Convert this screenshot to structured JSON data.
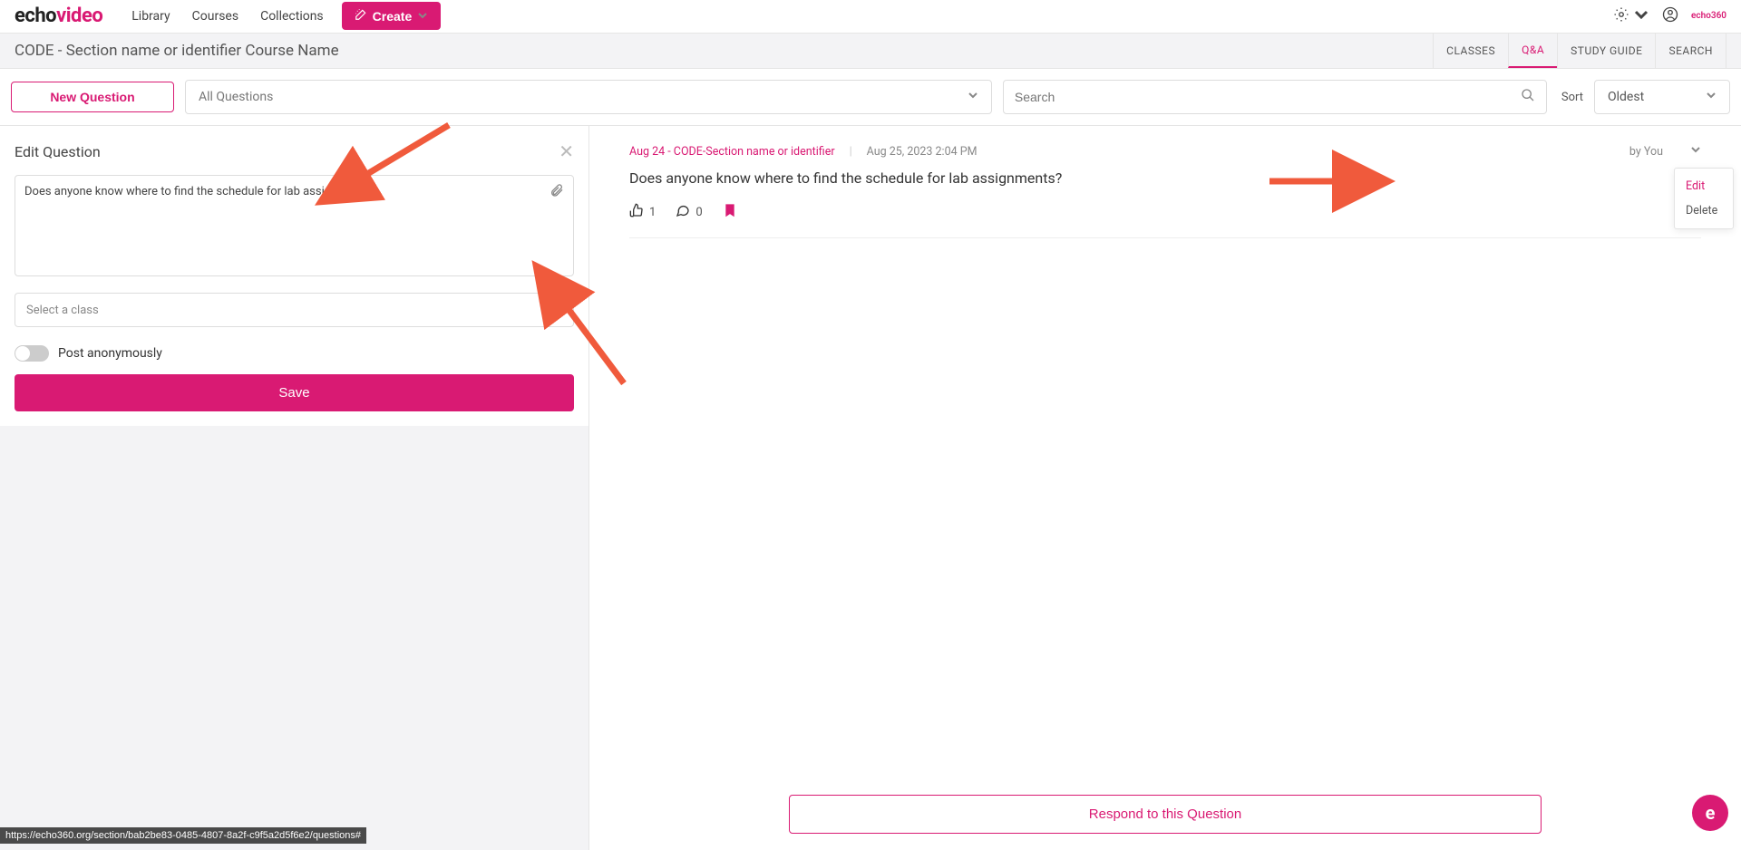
{
  "brand": {
    "part1": "echo",
    "part2": "video"
  },
  "nav": {
    "library": "Library",
    "courses": "Courses",
    "collections": "Collections",
    "create": "Create"
  },
  "echo_tag": "echo360",
  "course_title": "CODE - Section name or identifier Course Name",
  "tabs": {
    "classes": "CLASSES",
    "qa": "Q&A",
    "study_guide": "STUDY GUIDE",
    "search": "SEARCH"
  },
  "filters": {
    "new_question": "New Question",
    "all_questions": "All Questions",
    "search_placeholder": "Search",
    "sort_label": "Sort",
    "sort_value": "Oldest"
  },
  "edit_panel": {
    "title": "Edit Question",
    "text": "Does anyone know where to find the schedule for lab assignments?",
    "select_class": "Select a class",
    "post_anon": "Post anonymously",
    "save": "Save"
  },
  "question": {
    "class_link": "Aug 24 - CODE-Section name or identifier",
    "date": "Aug 25, 2023 2:04 PM",
    "by": "by You",
    "text": "Does anyone know where to find the schedule for lab assignments?",
    "likes": "1",
    "comments": "0"
  },
  "context_menu": {
    "edit": "Edit",
    "delete": "Delete"
  },
  "respond": "Respond to this Question",
  "status_url": "https://echo360.org/section/bab2be83-0485-4807-8a2f-c9f5a2d5f6e2/questions#"
}
